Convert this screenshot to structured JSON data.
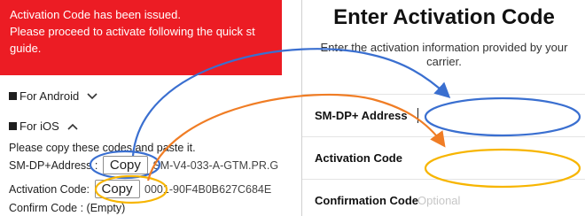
{
  "left": {
    "banner_lines": [
      "Activation Code has been issued.",
      "Please proceed to activate following the quick st",
      "guide."
    ],
    "accordion_android": "For Android",
    "accordion_ios": "For iOS",
    "instructions": "Please copy these codes and paste it.",
    "smdp_label": "SM-DP+Address :",
    "smdp_value": "SM-V4-033-A-GTM.PR.G",
    "activation_label": "Activation Code:",
    "activation_value": "0001-90F4B0B627C684E",
    "confirm_label": "Confirm Code : (Empty)",
    "copy_label": "Copy"
  },
  "right": {
    "title": "Enter Activation Code",
    "description": "Enter the activation information provided by your carrier.",
    "fields": [
      {
        "label": "SM-DP+ Address",
        "value": ""
      },
      {
        "label": "Activation Code",
        "value": ""
      },
      {
        "label": "Confirmation Code",
        "placeholder": "Optional"
      }
    ]
  },
  "colors": {
    "banner": "#ec1c24",
    "blue_annotation": "#3a6fd0",
    "orange_annotation": "#f07d25",
    "gold_annotation": "#f7b500"
  }
}
